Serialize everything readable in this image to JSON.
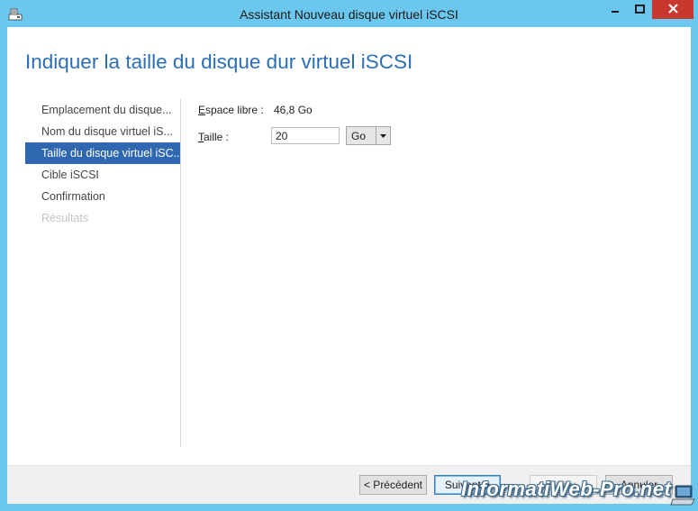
{
  "window": {
    "title": "Assistant Nouveau disque virtuel iSCSI"
  },
  "page": {
    "heading": "Indiquer la taille du disque dur virtuel iSCSI"
  },
  "nav": {
    "items": [
      {
        "label": "Emplacement du disque..."
      },
      {
        "label": "Nom du disque virtuel iS..."
      },
      {
        "label": "Taille du disque virtuel iSC..."
      },
      {
        "label": "Cible iSCSI"
      },
      {
        "label": "Confirmation"
      },
      {
        "label": "Résultats"
      }
    ]
  },
  "form": {
    "free_space_label_accel": "E",
    "free_space_label_rest": "space libre :",
    "free_space_value": "46,8 Go",
    "size_label_accel": "T",
    "size_label_rest": "aille :",
    "size_value": "20",
    "unit_selected": "Go"
  },
  "buttons": {
    "previous": "< Précédent",
    "next": "Suivant >",
    "create": "Créer",
    "cancel": "Annuler"
  },
  "watermark": {
    "text": "InformatiWeb-Pro.net"
  },
  "colors": {
    "title_bar": "#6bc7ee",
    "heading": "#2b6fb8",
    "nav_active": "#2f67b0",
    "close_button": "#c7392e"
  }
}
